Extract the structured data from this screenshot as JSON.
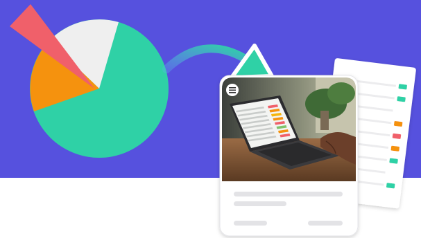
{
  "colors": {
    "background_band": "#5651de",
    "background_lower": "#ffffff",
    "pie_teal": "#2fd1a6",
    "pie_orange": "#f5920e",
    "pie_grey": "#efefef",
    "wedge_red": "#f0606a",
    "arrow_teal": "#2fd1a6",
    "card_white": "#ffffff",
    "placeholder_grey": "#e3e3e6",
    "marker_green": "#2fd1a6",
    "marker_orange": "#f5920e",
    "marker_red": "#f0606a"
  },
  "pie": {
    "slices": [
      {
        "name": "teal",
        "share": 0.66
      },
      {
        "name": "orange",
        "share": 0.15
      },
      {
        "name": "grey",
        "share": 0.19
      }
    ],
    "exploded_slice": "red"
  },
  "report_markers": [
    "green",
    "green",
    "none",
    "orange",
    "red",
    "orange",
    "green",
    "none",
    "green"
  ],
  "icons": {
    "card_badge": "list-icon",
    "arrow": "curved-arrow-icon"
  }
}
